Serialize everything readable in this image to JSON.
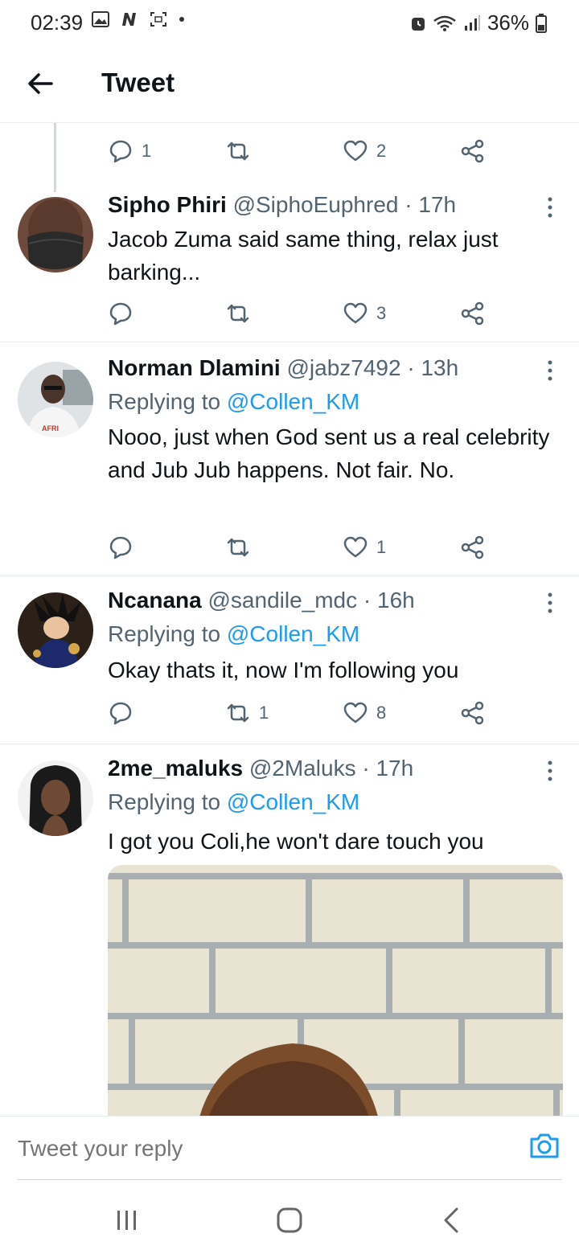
{
  "status_bar": {
    "time": "02:39",
    "battery": "36%"
  },
  "header": {
    "title": "Tweet"
  },
  "top_actions": {
    "reply_count": "1",
    "retweet_count": "",
    "like_count": "2"
  },
  "tweets": [
    {
      "name": "Sipho Phiri",
      "handle": "@SiphoEuphred",
      "time": "· 17h",
      "replying_label": "",
      "replying_to": "",
      "text": "Jacob Zuma said same thing, relax just barking...",
      "reply_count": "",
      "retweet_count": "",
      "like_count": "3"
    },
    {
      "name": "Norman Dlamini",
      "handle": "@jabz7492",
      "time": "· 13h",
      "replying_label": "Replying to",
      "replying_to": "@Collen_KM",
      "text": "Nooo, just when God sent us a real celebrity and Jub Jub happens. Not fair. No.",
      "reply_count": "",
      "retweet_count": "",
      "like_count": "1"
    },
    {
      "name": "Ncanana",
      "handle": "@sandile_mdc",
      "time": "· 16h",
      "replying_label": "Replying to",
      "replying_to": "@Collen_KM",
      "text": "Okay thats it, now I'm following you",
      "reply_count": "",
      "retweet_count": "1",
      "like_count": "8"
    },
    {
      "name": "2me_maluks",
      "handle": "@2Maluks",
      "time": "· 17h",
      "replying_label": "Replying to",
      "replying_to": "@Collen_KM",
      "text": "I got you Coli,he won't dare touch you"
    }
  ],
  "reply_bar": {
    "placeholder": "Tweet your reply"
  },
  "colors": {
    "accent": "#1d9bf0",
    "secondary_text": "#536471",
    "divider": "#e6ecf0"
  },
  "icons": [
    "back-arrow-icon",
    "reply-icon",
    "retweet-icon",
    "like-icon",
    "share-icon",
    "more-icon",
    "camera-icon",
    "recents-icon",
    "home-icon",
    "back-icon"
  ]
}
